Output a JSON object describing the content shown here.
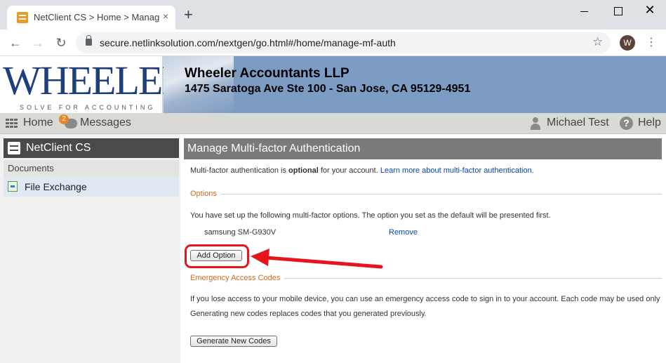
{
  "browser": {
    "tab_title": "NetClient CS > Home > Manage",
    "tab_close": "×",
    "new_tab": "+",
    "url": "secure.netlinksolution.com/nextgen/go.html#/home/manage-mf-auth",
    "avatar_letter": "W",
    "back": "←",
    "forward": "→",
    "reload": "↻",
    "star": "☆",
    "menu": "⋮",
    "close": "✕"
  },
  "banner": {
    "logo_word": "WHEELER",
    "logo_tagline": "SOLVE FOR ACCOUNTING",
    "firm_name": "Wheeler Accountants LLP",
    "firm_address": "1475 Saratoga Ave Ste 100 - San Jose, CA 95129-4951"
  },
  "nav": {
    "home": "Home",
    "messages": "Messages",
    "messages_badge": "2",
    "user": "Michael Test",
    "help_glyph": "?",
    "help": "Help"
  },
  "sidebar": {
    "app_name": "NetClient CS",
    "section": "Documents",
    "items": [
      {
        "label": "File Exchange"
      }
    ]
  },
  "main": {
    "title": "Manage Multi-factor Authentication",
    "intro_prefix": "Multi-factor authentication is ",
    "intro_bold": "optional",
    "intro_suffix": " for your account. ",
    "learn_more": "Learn more about multi-factor authentication.",
    "options_legend": "Options",
    "options_text": "You have set up the following multi-factor options. The option you set as the default will be presented first.",
    "device_name": "samsung SM-G930V",
    "remove_link": "Remove",
    "add_option_button": "Add Option",
    "emergency_legend": "Emergency Access Codes",
    "emergency_text_1": "If you lose access to your mobile device, you can use an emergency access code to sign in to your account. Each code may be used only",
    "emergency_text_2": "Generating new codes replaces codes that you generated previously.",
    "generate_button": "Generate New Codes"
  },
  "colors": {
    "banner_blue": "#7d9cc4",
    "logo_navy": "#1f3f7c",
    "header_dark": "#4a4a4a",
    "title_bar": "#7a7a7a",
    "legend_orange": "#d46b1a",
    "link_blue": "#0645ad",
    "annotation_red": "#e8141c"
  }
}
